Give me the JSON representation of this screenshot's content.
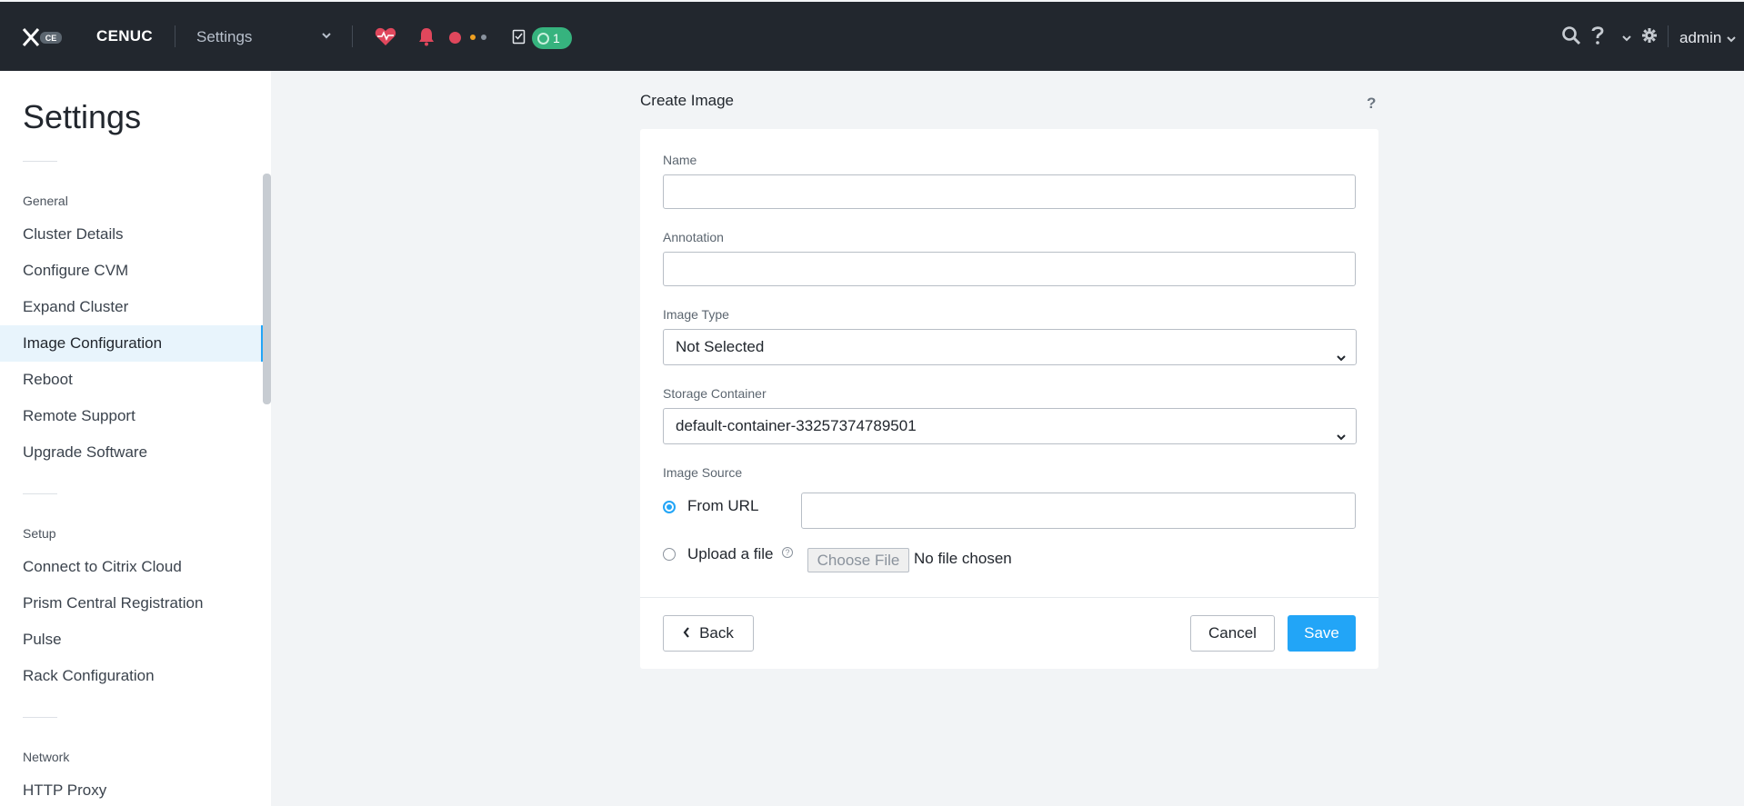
{
  "topbar": {
    "logo_badge": "CE",
    "cluster_name": "CENUC",
    "entity_selector": "Settings",
    "task_count": "1",
    "user": "admin",
    "icons": [
      "prism-logo-icon",
      "health-icon",
      "alert-bell-icon",
      "tasks-icon",
      "search-icon",
      "help-icon",
      "gear-icon",
      "chevron-down-icon"
    ]
  },
  "sidebar": {
    "title": "Settings",
    "groups": [
      {
        "label": "General",
        "items": [
          "Cluster Details",
          "Configure CVM",
          "Expand Cluster",
          "Image Configuration",
          "Reboot",
          "Remote Support",
          "Upgrade Software"
        ]
      },
      {
        "label": "Setup",
        "items": [
          "Connect to Citrix Cloud",
          "Prism Central Registration",
          "Pulse",
          "Rack Configuration"
        ]
      },
      {
        "label": "Network",
        "items": [
          "HTTP Proxy"
        ]
      }
    ],
    "active_item": "Image Configuration"
  },
  "form": {
    "title": "Create Image",
    "help": "?",
    "name_label": "Name",
    "name_value": "",
    "annotation_label": "Annotation",
    "annotation_value": "",
    "image_type_label": "Image Type",
    "image_type_value": "Not Selected",
    "storage_label": "Storage Container",
    "storage_value": "default-container-33257374789501",
    "source_label": "Image Source",
    "from_url_label": "From URL",
    "url_value": "",
    "upload_label": "Upload a file",
    "upload_info": "?",
    "choose_file": "Choose File",
    "no_file": "No file chosen",
    "back": "Back",
    "cancel": "Cancel",
    "save": "Save"
  },
  "colors": {
    "topbar_bg": "#22272e",
    "accent": "#22a5f7",
    "task_badge": "#36b37e",
    "alert_red": "#e0475c",
    "health_red": "#e0475c"
  }
}
